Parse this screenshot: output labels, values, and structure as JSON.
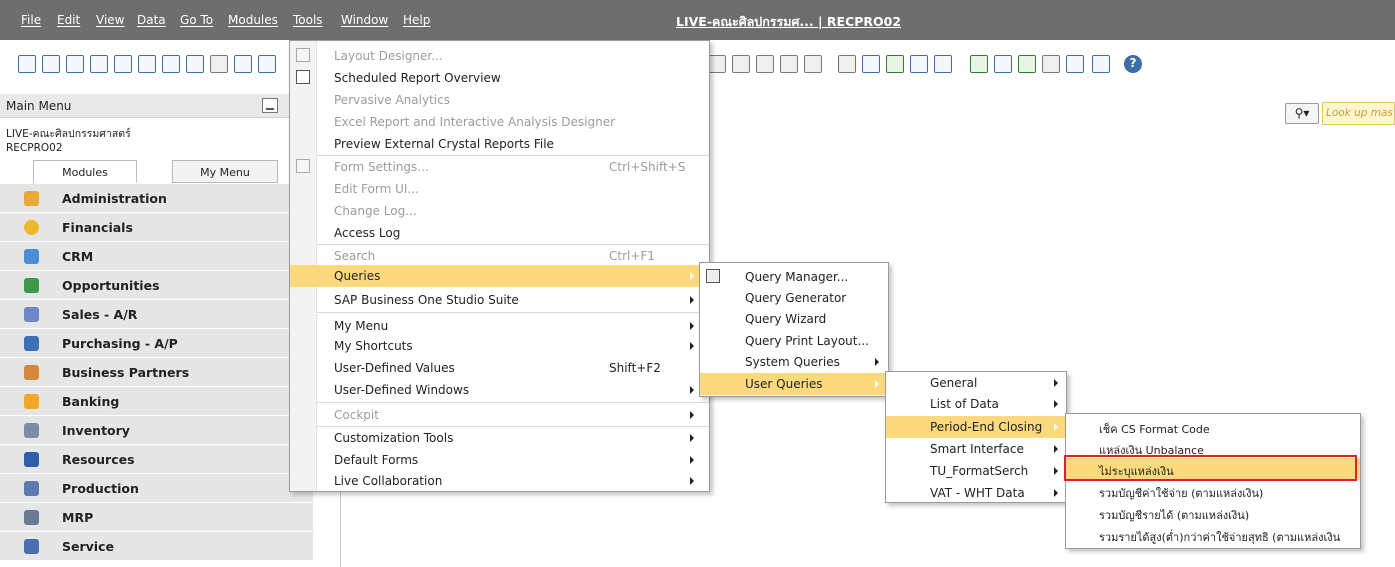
{
  "menubar": {
    "items": [
      "File",
      "Edit",
      "View",
      "Data",
      "Go To",
      "Modules",
      "Tools",
      "Window",
      "Help"
    ],
    "title": "LIVE-คณะศิลปกรรมศ... | RECPRO02"
  },
  "main_menu": {
    "header": "Main Menu",
    "database": "LIVE-คณะศิลปกรรมศาสตร์",
    "user": "RECPRO02",
    "tabs": [
      "Modules",
      "My Menu"
    ],
    "modules": [
      {
        "label": "Administration",
        "icon": "administration-icon"
      },
      {
        "label": "Financials",
        "icon": "financials-icon"
      },
      {
        "label": "CRM",
        "icon": "crm-icon"
      },
      {
        "label": "Opportunities",
        "icon": "opportunities-icon"
      },
      {
        "label": "Sales - A/R",
        "icon": "sales-icon"
      },
      {
        "label": "Purchasing - A/P",
        "icon": "cart-icon"
      },
      {
        "label": "Business Partners",
        "icon": "partners-icon"
      },
      {
        "label": "Banking",
        "icon": "banking-icon"
      },
      {
        "label": "Inventory",
        "icon": "inventory-icon"
      },
      {
        "label": "Resources",
        "icon": "resources-icon"
      },
      {
        "label": "Production",
        "icon": "production-icon"
      },
      {
        "label": "MRP",
        "icon": "mrp-icon"
      },
      {
        "label": "Service",
        "icon": "service-icon"
      }
    ]
  },
  "search": {
    "placeholder": "Look up mas"
  },
  "tools_menu": {
    "items": [
      {
        "label": "Layout Designer...",
        "disabled": true
      },
      {
        "label": "Scheduled Report Overview"
      },
      {
        "label": "Pervasive Analytics",
        "disabled": true
      },
      {
        "label": "Excel Report and Interactive Analysis Designer",
        "disabled": true
      },
      {
        "label": "Preview External Crystal Reports File"
      },
      {
        "label": "Form Settings...",
        "shortcut": "Ctrl+Shift+S",
        "disabled": true
      },
      {
        "label": "Edit Form UI...",
        "disabled": true
      },
      {
        "label": "Change Log...",
        "disabled": true
      },
      {
        "label": "Access Log"
      },
      {
        "label": "Search",
        "shortcut": "Ctrl+F1",
        "disabled": true
      },
      {
        "label": "Queries",
        "submenu": true,
        "highlighted": true
      },
      {
        "label": "SAP Business One Studio Suite",
        "submenu": true
      },
      {
        "label": "My Menu",
        "submenu": true
      },
      {
        "label": "My Shortcuts",
        "submenu": true
      },
      {
        "label": "User-Defined Values",
        "shortcut": "Shift+F2"
      },
      {
        "label": "User-Defined Windows",
        "submenu": true
      },
      {
        "label": "Cockpit",
        "submenu": true,
        "disabled": true
      },
      {
        "label": "Customization Tools",
        "submenu": true
      },
      {
        "label": "Default Forms",
        "submenu": true
      },
      {
        "label": "Live Collaboration",
        "submenu": true
      }
    ]
  },
  "queries_menu": {
    "items": [
      {
        "label": "Query Manager..."
      },
      {
        "label": "Query Generator"
      },
      {
        "label": "Query Wizard"
      },
      {
        "label": "Query Print Layout..."
      },
      {
        "label": "System Queries",
        "submenu": true
      },
      {
        "label": "User Queries",
        "submenu": true,
        "highlighted": true
      }
    ]
  },
  "user_queries_menu": {
    "items": [
      {
        "label": "General",
        "submenu": true
      },
      {
        "label": "List of Data",
        "submenu": true
      },
      {
        "label": "Period-End Closing",
        "submenu": true,
        "highlighted": true
      },
      {
        "label": "Smart Interface",
        "submenu": true
      },
      {
        "label": "TU_FormatSerch",
        "submenu": true
      },
      {
        "label": "VAT - WHT Data",
        "submenu": true
      }
    ]
  },
  "period_end_menu": {
    "items": [
      {
        "label": "เช็ค CS Format Code"
      },
      {
        "label": "แหล่งเงิน Unbalance"
      },
      {
        "label": "ไม่ระบุแหล่งเงิน",
        "highlighted": true,
        "boxed": true
      },
      {
        "label": "รวมบัญชีค่าใช้จ่าย (ตามแหล่งเงิน)"
      },
      {
        "label": "รวมบัญชีรายได้ (ตามแหล่งเงิน)"
      },
      {
        "label": "รวมรายได้สูง(ต่ำ)กว่าค่าใช้จ่ายสุทธิ (ตามแหล่งเงิน"
      }
    ]
  },
  "colors": {
    "menubar": "#6e6e6e",
    "highlight": "#fbd97c",
    "red_box": "#e0202a"
  }
}
